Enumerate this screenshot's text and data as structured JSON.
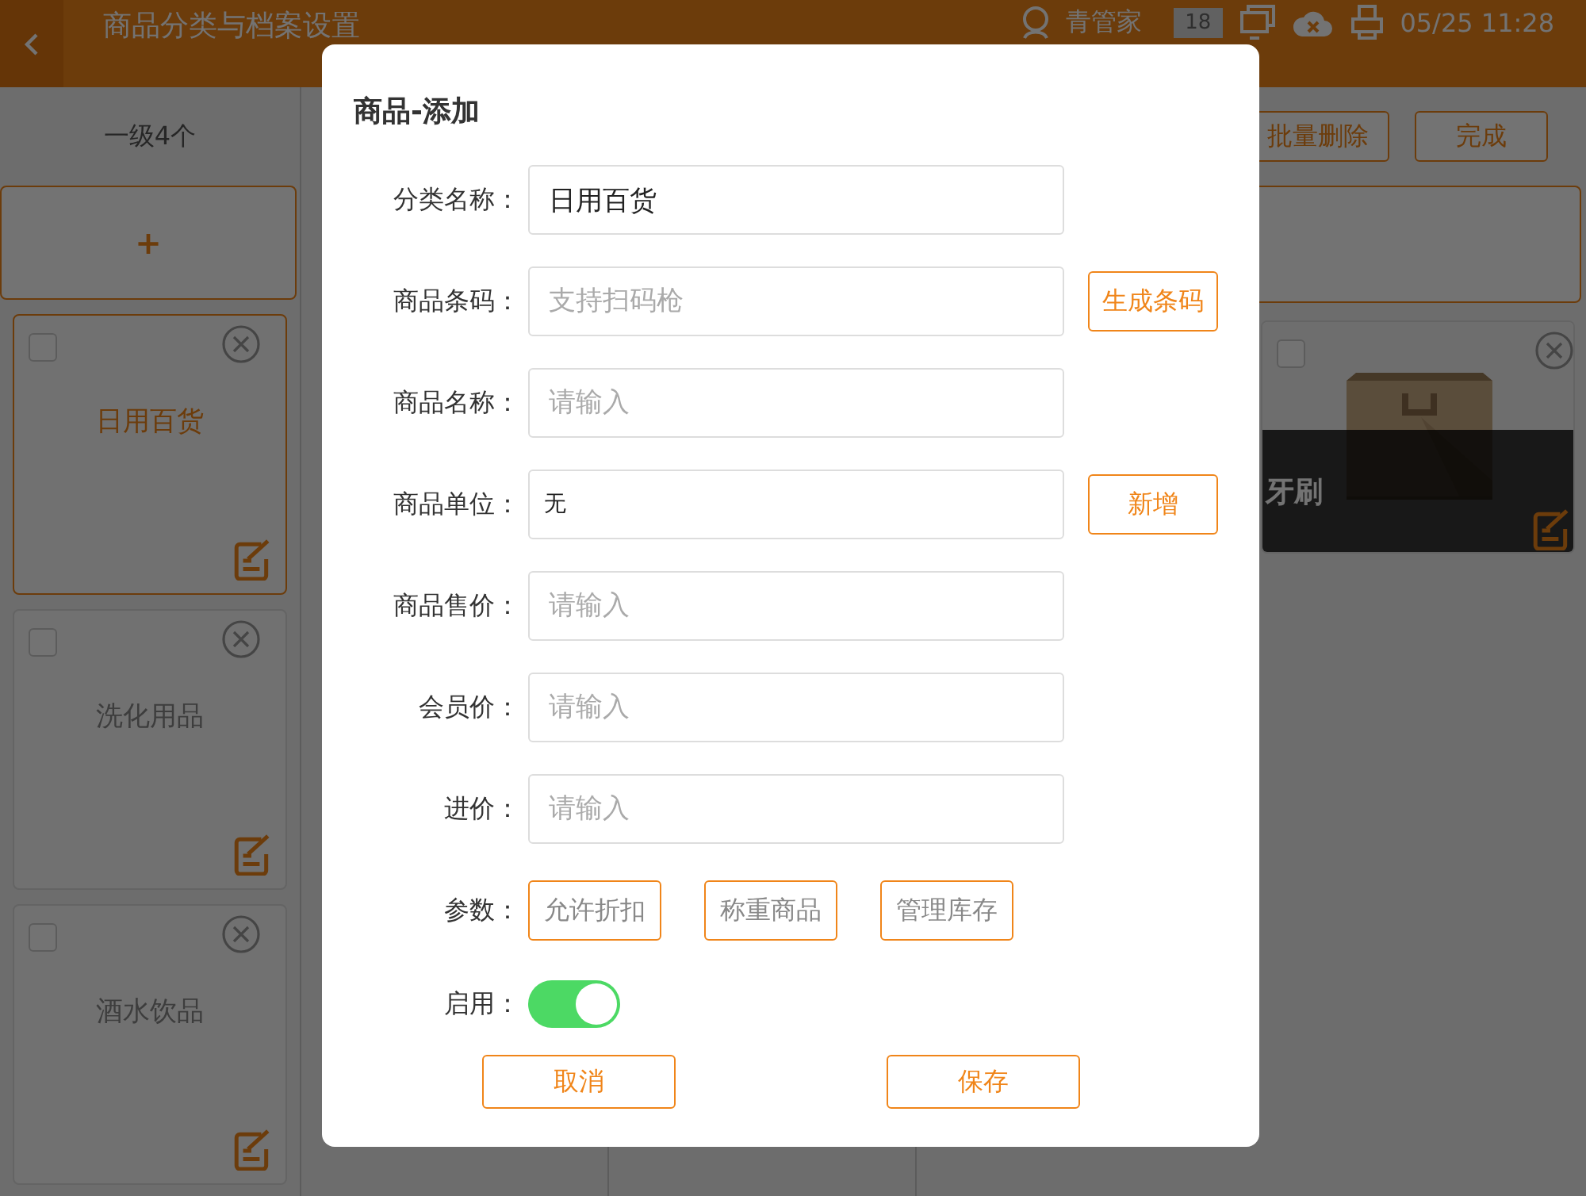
{
  "header": {
    "title": "商品分类与档案设置",
    "user": "青管家",
    "badge": "18",
    "datetime": "05/25 11:28"
  },
  "sidebar": {
    "heading": "一级4个",
    "add_label": "+",
    "categories": [
      {
        "name": "日用百货",
        "selected": true,
        "checked": false
      },
      {
        "name": "洗化用品",
        "selected": false,
        "checked": false
      },
      {
        "name": "酒水饮品",
        "selected": false,
        "checked": false
      }
    ]
  },
  "toolbar": {
    "buttons": [
      "批量删除",
      "完成"
    ]
  },
  "products": [
    {
      "name": "牙刷",
      "checked": false
    }
  ],
  "dialog": {
    "title": "商品-添加",
    "fields": [
      {
        "label": "分类名称：",
        "value": "日用百货"
      },
      {
        "label": "商品条码：",
        "placeholder": "支持扫码枪",
        "action": "生成条码"
      },
      {
        "label": "商品名称：",
        "placeholder": "请输入"
      },
      {
        "label": "商品单位：",
        "value": "无",
        "action": "新增"
      },
      {
        "label": "商品售价：",
        "placeholder": "请输入"
      },
      {
        "label": "会员价：",
        "placeholder": "请输入"
      },
      {
        "label": "进价：",
        "placeholder": "请输入"
      }
    ],
    "params": {
      "label": "参数：",
      "options": [
        {
          "label": "允许折扣",
          "selected": false
        },
        {
          "label": "称重商品",
          "selected": false
        },
        {
          "label": "管理库存",
          "selected": false
        }
      ]
    },
    "enable": {
      "label": "启用：",
      "on": true
    },
    "buttons": [
      "取消",
      "保存"
    ]
  }
}
